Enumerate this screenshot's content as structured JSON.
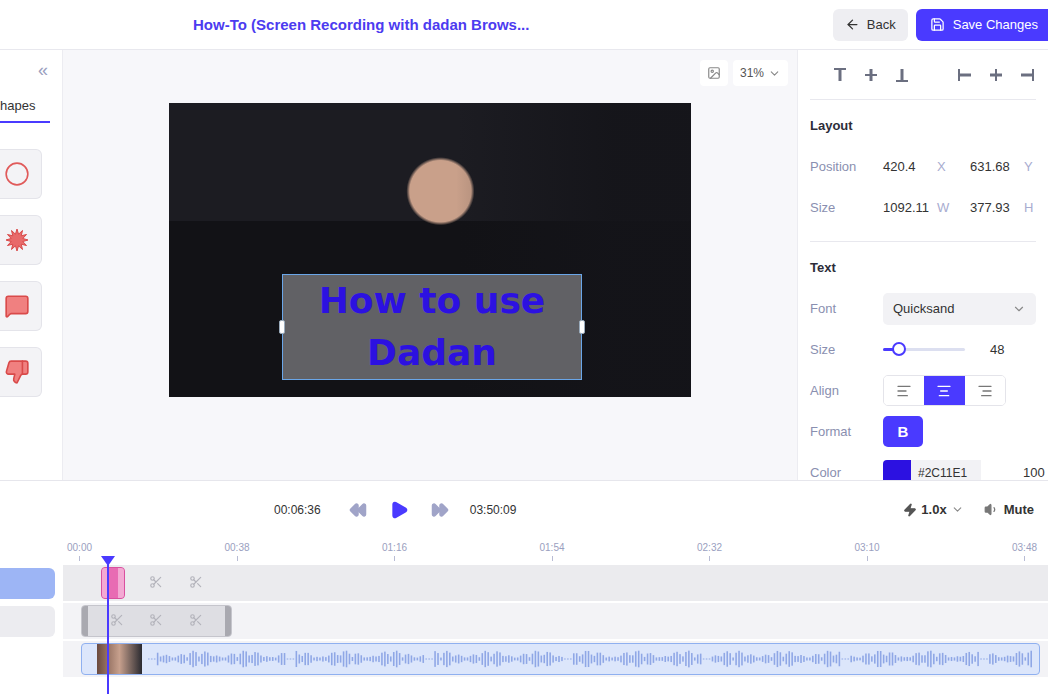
{
  "topbar": {
    "title": "How-To (Screen Recording with dadan Brows...",
    "back": "Back",
    "save": "Save Changes"
  },
  "leftPanel": {
    "collapse": "«",
    "tabs": [
      {
        "label": "hapes",
        "selected": true
      }
    ],
    "shapes": [
      {
        "kind": "circle"
      },
      {
        "kind": "burst"
      },
      {
        "kind": "bubble"
      },
      {
        "kind": "thumbs-down"
      }
    ]
  },
  "canvas": {
    "zoom": "31%",
    "overlay": {
      "text": "How to use Dadan",
      "selected": true
    }
  },
  "properties": {
    "alignTools": [
      {
        "kind": "top"
      },
      {
        "kind": "middle"
      },
      {
        "kind": "bottom"
      },
      {
        "kind": "left"
      },
      {
        "kind": "center"
      },
      {
        "kind": "right"
      }
    ],
    "layout": {
      "title": "Layout",
      "rows": [
        {
          "label": "Position",
          "a": "420.4",
          "aUnit": "X",
          "b": "631.68",
          "bUnit": "Y"
        },
        {
          "label": "Size",
          "a": "1092.11",
          "aUnit": "W",
          "b": "377.93",
          "bUnit": "H"
        }
      ]
    },
    "text": {
      "title": "Text",
      "font": {
        "label": "Font",
        "value": "Quicksand"
      },
      "size": {
        "label": "Size",
        "value": "48",
        "level": 0.2
      },
      "align": {
        "label": "Align",
        "options": [
          {
            "kind": "left",
            "selected": false
          },
          {
            "kind": "center",
            "selected": true
          },
          {
            "kind": "right",
            "selected": false
          }
        ]
      },
      "format": {
        "label": "Format",
        "options": [
          {
            "label": "B",
            "selected": true
          }
        ]
      },
      "color": {
        "label": "Color",
        "hex": "#2C11E1",
        "opacity": "100",
        "unit": "%"
      }
    }
  },
  "playback": {
    "current": "00:06:36",
    "total": "03:50:09",
    "speed": "1.0x",
    "mute": "Mute",
    "playhead": 0.046
  },
  "timeline": {
    "ticks": [
      "00:00",
      "00:38",
      "01:16",
      "01:54",
      "02:32",
      "03:10",
      "03:48"
    ],
    "tracks": [
      {
        "kind": "text",
        "selected": true,
        "clips": [
          {
            "start": 0.039,
            "end": 0.063
          }
        ],
        "cuts": [
          0.094,
          0.135
        ]
      },
      {
        "kind": "shape",
        "selected": false,
        "clips": [
          {
            "start": 0.018,
            "end": 0.172
          }
        ],
        "cuts": [
          0.055,
          0.094,
          0.135
        ]
      },
      {
        "kind": "video",
        "selected": false,
        "clips": [
          {
            "start": 0.018,
            "end": 0.992
          }
        ],
        "cuts": []
      }
    ]
  }
}
